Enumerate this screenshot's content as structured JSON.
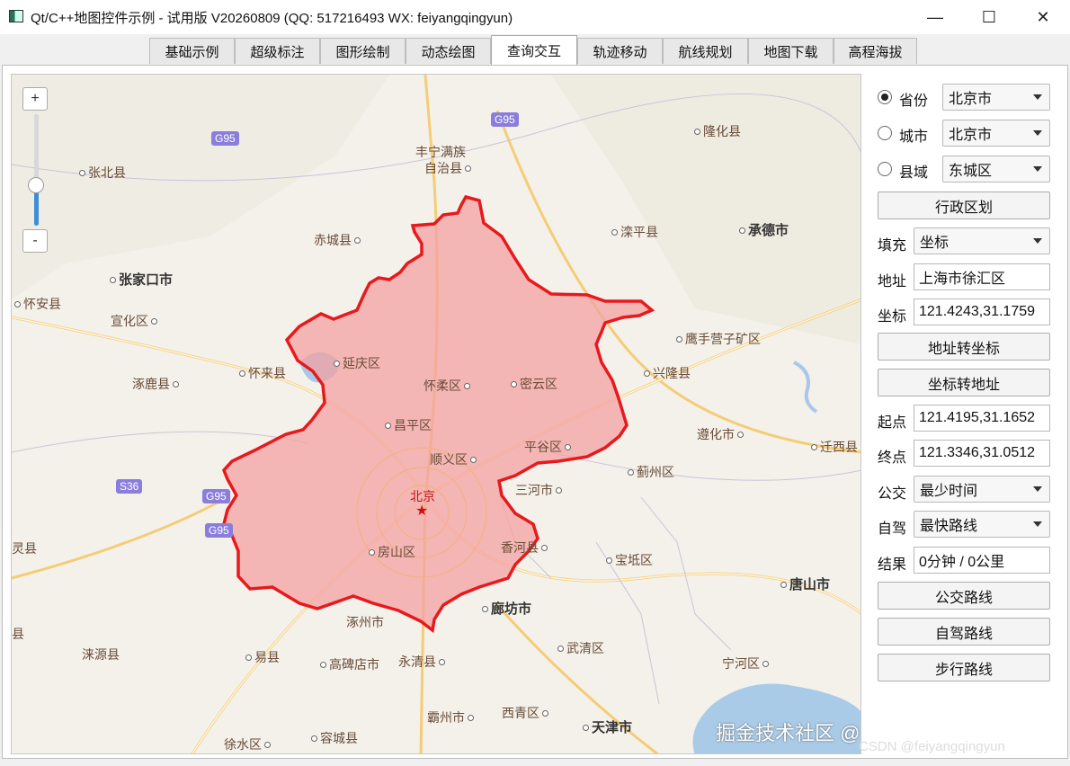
{
  "window": {
    "title": "Qt/C++地图控件示例 - 试用版 V20260809 (QQ: 517216493 WX: feiyangqingyun)",
    "minimize": "—",
    "maximize": "☐",
    "close": "✕"
  },
  "tabs": [
    {
      "label": "基础示例"
    },
    {
      "label": "超级标注"
    },
    {
      "label": "图形绘制"
    },
    {
      "label": "动态绘图"
    },
    {
      "label": "查询交互",
      "active": true
    },
    {
      "label": "轨迹移动"
    },
    {
      "label": "航线规划"
    },
    {
      "label": "地图下载"
    },
    {
      "label": "高程海拔"
    }
  ],
  "map": {
    "zoom_in": "+",
    "zoom_out": "-",
    "zoom_level_fraction": 0.35,
    "highlight_color": "#f4a2a2",
    "boundary_color": "#e8191d",
    "labels": [
      "张北县",
      "丰宁满族",
      "自治县",
      "隆化县",
      "赤城县",
      "滦平县",
      "承德市",
      "张家口市",
      "怀安县",
      "宣化区",
      "延庆区",
      "鹰手营子矿区",
      "涿鹿县",
      "怀来县",
      "怀柔区",
      "密云区",
      "兴隆县",
      "昌平区",
      "遵化市",
      "平谷区",
      "迁西县",
      "顺义区",
      "蓟州区",
      "三河市",
      "北京",
      "房山区",
      "香河县",
      "宝坻区",
      "唐山市",
      "涿州市",
      "廊坊市",
      "涞源县",
      "易县",
      "高碑店市",
      "永清县",
      "武清区",
      "宁河区",
      "霸州市",
      "西青区",
      "天津市",
      "徐水区",
      "容城县",
      "灵县",
      "县"
    ],
    "road_shields": [
      "G95",
      "G95",
      "S36",
      "G95",
      "G95"
    ],
    "watermark": "掘金技术社区 @ feiyangqingyun",
    "watermark_sub": "CSDN @feiyangqingyun"
  },
  "panel": {
    "province_radio": "省份",
    "province_value": "北京市",
    "city_radio": "城市",
    "city_value": "北京市",
    "county_radio": "县域",
    "county_value": "东城区",
    "admin_button": "行政区划",
    "fill_label": "填充",
    "fill_value": "坐标",
    "address_label": "地址",
    "address_value": "上海市徐汇区",
    "coord_label": "坐标",
    "coord_value": "121.4243,31.1759",
    "addr_to_coord_button": "地址转坐标",
    "coord_to_addr_button": "坐标转地址",
    "start_label": "起点",
    "start_value": "121.4195,31.1652",
    "end_label": "终点",
    "end_value": "121.3346,31.0512",
    "bus_label": "公交",
    "bus_value": "最少时间",
    "drive_label": "自驾",
    "drive_value": "最快路线",
    "result_label": "结果",
    "result_value": "0分钟 / 0公里",
    "bus_route_button": "公交路线",
    "drive_route_button": "自驾路线",
    "walk_route_button": "步行路线"
  }
}
